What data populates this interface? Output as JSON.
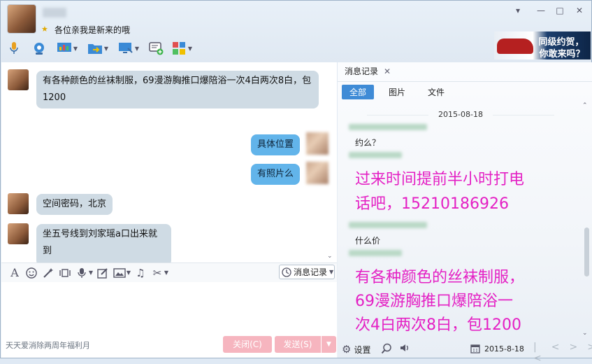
{
  "header": {
    "signature": "各位亲我是新来的哦",
    "window_controls": {
      "menu": "▾",
      "minimize": "—",
      "maximize": "□",
      "close": "✕"
    }
  },
  "ad": {
    "line1": "同级约贺，",
    "line2": "你敢来吗？"
  },
  "chat": {
    "messages": [
      {
        "side": "left",
        "text": "有各种颜色的丝袜制服，69漫游胸推口爆陪浴一次4白两次8白，包1200"
      },
      {
        "side": "right",
        "text": "具体位置"
      },
      {
        "side": "right",
        "text": "有照片么"
      },
      {
        "side": "left",
        "text": "空间密码，北京"
      },
      {
        "side": "left",
        "text": "坐五号线到刘家瑶a口出来就到"
      }
    ]
  },
  "input": {
    "message_log_label": "消息记录",
    "bottom_text": "天天爱消除两周年福利月",
    "close_label": "关闭(C)",
    "send_label": "发送(S)"
  },
  "side": {
    "tab_label": "消息记录",
    "filters": [
      "全部",
      "图片",
      "文件"
    ],
    "active_filter": "全部",
    "date": "2015-08-18",
    "msgs": {
      "m1": "约么？",
      "m2_line1": "过来时间提前半小时打电",
      "m2_line2": "话吧，15210186926",
      "m3": "什么价",
      "m4_line1": "有各种颜色的丝袜制服，",
      "m4_line2": "69漫游胸推口爆陪浴一",
      "m4_line3": "次4白两次8白，包1200"
    },
    "settings_label": "设置",
    "footer_date": "2015-8-18",
    "nav": [
      "|<",
      "<",
      ">",
      ">|"
    ]
  },
  "colors": {
    "accent": "#3f8bd6",
    "bubble_right": "#62b4ea",
    "bubble_left": "#cfdbe4",
    "highlight_text": "#e420c4",
    "button_pink": "#f6b5bf"
  }
}
